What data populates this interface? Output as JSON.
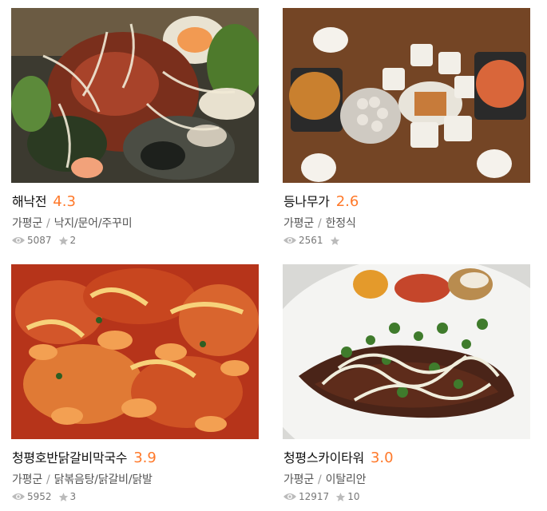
{
  "restaurants": [
    {
      "name": "해낙전",
      "rating": "4.3",
      "region": "가평군",
      "category": "낙지/문어/주꾸미",
      "views": "5087",
      "favorites": "2",
      "photo": "seafood-hotpot-photo"
    },
    {
      "name": "등나무가",
      "rating": "2.6",
      "region": "가평군",
      "category": "한정식",
      "views": "2561",
      "favorites": "",
      "photo": "korean-table-set-photo"
    },
    {
      "name": "청평호반닭갈비막국수",
      "rating": "3.9",
      "region": "가평군",
      "category": "닭볶음탕/닭갈비/닭발",
      "views": "5952",
      "favorites": "3",
      "photo": "spicy-chicken-photo"
    },
    {
      "name": "청평스카이타워",
      "rating": "3.0",
      "region": "가평군",
      "category": "이탈리안",
      "views": "12917",
      "favorites": "10",
      "photo": "steak-plate-photo"
    }
  ],
  "colors": {
    "rating": "#ff792a",
    "icon": "#bbbbbb"
  },
  "icons": {
    "views": "eye-icon",
    "favorites": "star-icon"
  }
}
